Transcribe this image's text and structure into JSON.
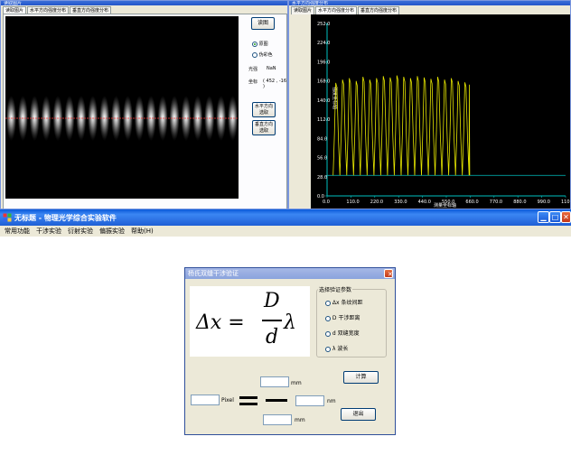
{
  "left_window": {
    "title": "读取图片",
    "tabs": [
      "读取图片",
      "水平方向强度分布",
      "垂直方向强度分布"
    ],
    "read_button": "读图",
    "radio_options": [
      {
        "label": "原图",
        "checked": true
      },
      {
        "label": "伪彩色",
        "checked": false
      }
    ],
    "light_intensity_label": "光强",
    "light_intensity_value": "NaN",
    "coord_label": "坐标",
    "coord_value": "( 452 , -16 )",
    "horizontal_select_button": [
      "水平方向",
      "选取"
    ],
    "vertical_select_button": [
      "垂直方向",
      "选取"
    ],
    "fringe_count": 20
  },
  "right_window": {
    "title": "水平方向强度分布",
    "tabs": [
      "读取图片",
      "水平方向强度分布",
      "垂直方向强度分布"
    ],
    "chart_data": {
      "type": "line",
      "xlabel": "测量坐标轴",
      "ylabel": "强度坐标轴",
      "x_ticks": [
        "0.0",
        "110.0",
        "220.0",
        "330.0",
        "440.0",
        "550.0",
        "660.0",
        "770.0",
        "880.0",
        "990.0",
        "110"
      ],
      "y_ticks": [
        "0.0",
        "28.0",
        "56.0",
        "84.0",
        "112.0",
        "140.0",
        "168.0",
        "196.0",
        "224.0",
        "252.0"
      ],
      "xlim": [
        0,
        1100
      ],
      "ylim": [
        0,
        252
      ],
      "baseline": 30,
      "peak_count": 20,
      "peak_values": [
        165,
        170,
        172,
        168,
        174,
        170,
        172,
        175,
        173,
        176,
        174,
        172,
        175,
        173,
        171,
        174,
        170,
        172,
        168,
        166
      ],
      "trough_value": 30,
      "data_x_range": [
        28,
        655
      ],
      "colors": {
        "trace": "#e6e600",
        "axis": "#00c0c0",
        "labels": "#ffffff",
        "background": "#000000"
      }
    }
  },
  "main_window": {
    "title": "无标题 - 物理光学综合实验软件",
    "menu": [
      "常用功能",
      "干涉实验",
      "衍射实验",
      "偏振实验",
      "帮助(H)"
    ]
  },
  "dialog": {
    "title": "杨氏双缝干涉验证",
    "formula_lhs": "Δx =",
    "formula_num": "D",
    "formula_den": "d",
    "formula_lambda": "λ",
    "group_title": "选择验证参数",
    "options": [
      {
        "label": "Δx 条纹间距",
        "checked": false
      },
      {
        "label": "D 干涉距离",
        "checked": false
      },
      {
        "label": "d 双缝宽度",
        "checked": false
      },
      {
        "label": "λ 波长",
        "checked": false
      }
    ],
    "calc_button": "计算",
    "exit_button": "退出",
    "pixel_label": "Pixel",
    "top_unit": "mm",
    "right_unit": "nm",
    "bottom_unit": "mm",
    "pixel_value": "",
    "top_value": "",
    "right_value": "",
    "bottom_value": ""
  }
}
